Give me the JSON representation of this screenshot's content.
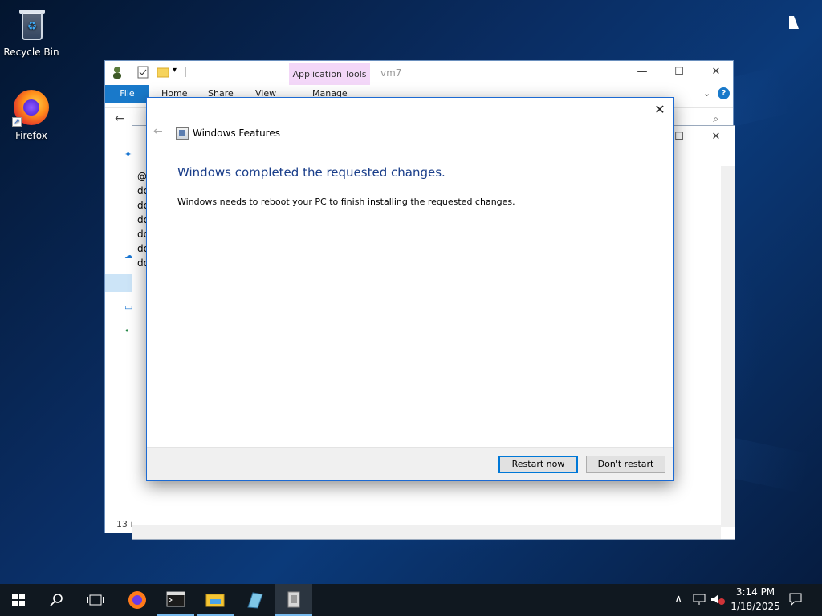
{
  "desktop": {
    "icons": [
      {
        "label": "Recycle Bin"
      },
      {
        "label": "Firefox"
      }
    ]
  },
  "explorer": {
    "title": "vm7",
    "context_tab": "Application Tools",
    "ribbon_tabs": [
      "File",
      "Home",
      "Share",
      "View",
      "Manage"
    ],
    "status_fragment": "13 i",
    "list_fragments": [
      "@e",
      "do",
      "do",
      "do",
      "do",
      "do",
      "do"
    ]
  },
  "dialog": {
    "app_title": "Windows Features",
    "heading": "Windows completed the requested changes.",
    "message": "Windows needs to reboot your PC to finish installing the requested changes.",
    "buttons": {
      "primary": "Restart now",
      "secondary": "Don't restart"
    }
  },
  "taskbar": {
    "clock_time": "3:14 PM",
    "clock_date": "1/18/2025",
    "accent": "#76b9ed"
  }
}
